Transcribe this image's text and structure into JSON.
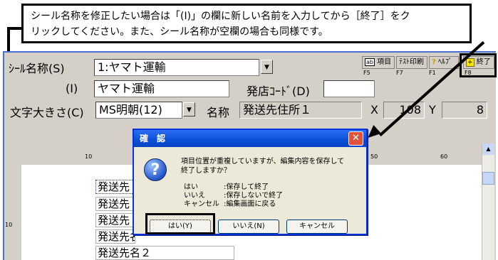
{
  "callout": {
    "line1": "シール名称を修正したい場合は「(I)」の欄に新しい名前を入力してから［終了］をク",
    "line2": "リックしてください。また、シール名称が空欄の場合も同様です。"
  },
  "form": {
    "seal_name_label": "ｼｰﾙ名称(S)",
    "seal_name_value": "1:ヤマト運輸",
    "i_label": "(I)",
    "i_value": "ヤマト運輸",
    "shop_code_label": "発店ｺｰﾄﾞ(D)",
    "shop_code_value": "",
    "font_size_label": "文字大きさ(C)",
    "font_size_value": "MS明朝(12)",
    "name_label": "名称",
    "name_value": "発送先住所１",
    "x_label": "X",
    "x_value": "108",
    "y_label": "Y",
    "y_value": "8"
  },
  "toolbar": {
    "items_label": "項目",
    "items_key": "F5",
    "test_print_label": "ﾃｽﾄ印刷",
    "test_print_key": "F7",
    "help_label": "ﾍﾙﾌﾟ",
    "help_key": "F1",
    "exit_label": "終了",
    "exit_key": "F8"
  },
  "ruler": {
    "ticks": [
      "10",
      "50",
      "60"
    ],
    "row_mark": "10"
  },
  "canvas": {
    "items": [
      "発送先",
      "発送先",
      "発送先",
      "発送先名",
      "発送先名２"
    ]
  },
  "dialog": {
    "title": "確　認",
    "message1": "項目位置が重複していますが、編集内容を保存して",
    "message2": "終了しますか？",
    "opt1_key": "はい",
    "opt1_desc": ":保存して終了",
    "opt2_key": "いいえ",
    "opt2_desc": ":保存しないで終了",
    "opt3_key": "キャンセル",
    "opt3_desc": ":編集画面に戻る",
    "yes_label": "はい(Y)",
    "no_label": "いいえ(N)",
    "cancel_label": "キャンセル",
    "close_glyph": "✕",
    "icon_glyph": "?"
  }
}
